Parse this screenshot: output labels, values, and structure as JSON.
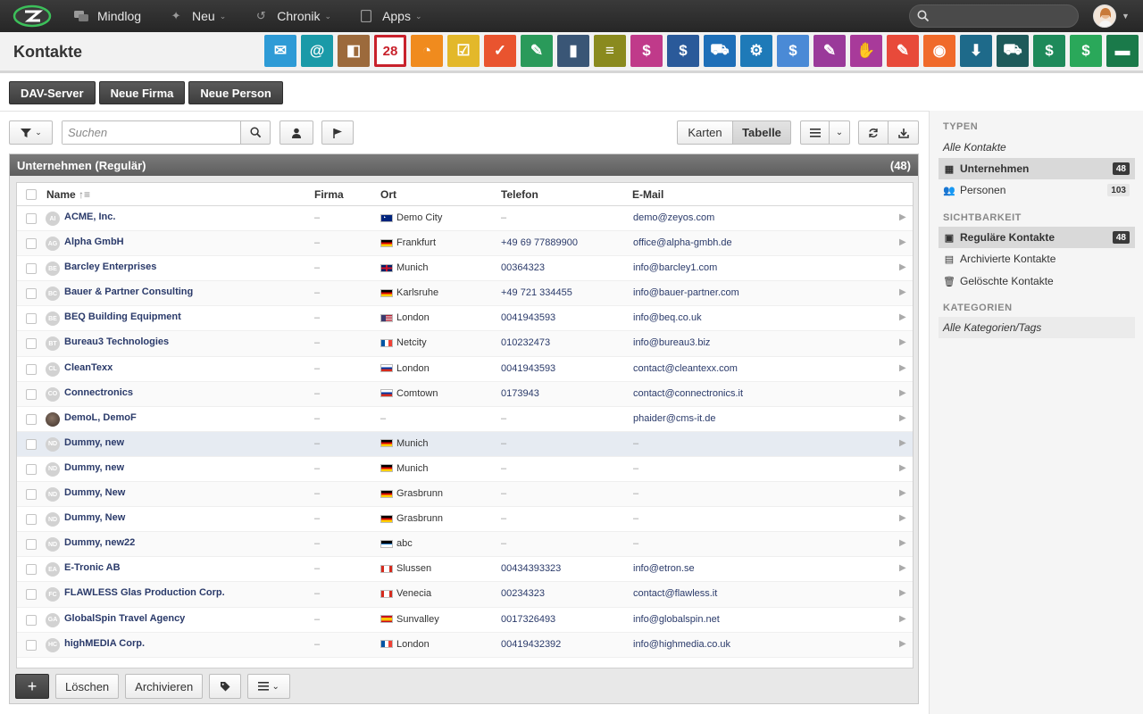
{
  "topnav": {
    "items": [
      {
        "label": "Mindlog",
        "icon": "chat-icon",
        "chevron": false
      },
      {
        "label": "Neu",
        "icon": "sparkle-icon",
        "chevron": true
      },
      {
        "label": "Chronik",
        "icon": "history-icon",
        "chevron": true
      },
      {
        "label": "Apps",
        "icon": "tablet-icon",
        "chevron": true
      }
    ],
    "search_placeholder": ""
  },
  "header": {
    "title": "Kontakte",
    "app_icons": [
      {
        "name": "mail-app",
        "color": "#2e9bd6",
        "glyph": "✉"
      },
      {
        "name": "addressbook-app",
        "color": "#1a9aa8",
        "glyph": "@"
      },
      {
        "name": "contacts-app",
        "color": "#9c6a3c",
        "glyph": "◧"
      },
      {
        "name": "calendar-app",
        "color": "#c8212b",
        "glyph": "28"
      },
      {
        "name": "timer-app",
        "color": "#f08b1e",
        "glyph": "◔"
      },
      {
        "name": "tasks-app",
        "color": "#e3b82a",
        "glyph": "☑"
      },
      {
        "name": "projects-app",
        "color": "#e9542f",
        "glyph": "✓"
      },
      {
        "name": "notes-app",
        "color": "#2a9a5a",
        "glyph": "✎"
      },
      {
        "name": "bookmark-app",
        "color": "#3a5676",
        "glyph": "▮"
      },
      {
        "name": "documents-app",
        "color": "#8a8a1e",
        "glyph": "≡"
      },
      {
        "name": "cashdesk-app",
        "color": "#c03a8a",
        "glyph": "$"
      },
      {
        "name": "finance-app",
        "color": "#2a5a9a",
        "glyph": "$"
      },
      {
        "name": "delivery-app",
        "color": "#1e6fb8",
        "glyph": "⛟"
      },
      {
        "name": "support-app",
        "color": "#1e7ab8",
        "glyph": "⚙"
      },
      {
        "name": "money-app",
        "color": "#4a8ad6",
        "glyph": "$"
      },
      {
        "name": "contracts-app",
        "color": "#9a3a9a",
        "glyph": "✎"
      },
      {
        "name": "deals-app",
        "color": "#a83a9a",
        "glyph": "✋"
      },
      {
        "name": "pdf-app",
        "color": "#e84a3a",
        "glyph": "✎"
      },
      {
        "name": "broadcast-app",
        "color": "#f06a2a",
        "glyph": "◉"
      },
      {
        "name": "download-app",
        "color": "#1e6a8a",
        "glyph": "⬇"
      },
      {
        "name": "shop-app",
        "color": "#1e5a5a",
        "glyph": "⛟"
      },
      {
        "name": "billing-app",
        "color": "#1e8a5a",
        "glyph": "$"
      },
      {
        "name": "tags-app",
        "color": "#2aa85a",
        "glyph": "$"
      },
      {
        "name": "database-app",
        "color": "#1a7a4a",
        "glyph": "▬"
      }
    ]
  },
  "actions": {
    "dav": "DAV-Server",
    "new_company": "Neue Firma",
    "new_person": "Neue Person"
  },
  "toolbar": {
    "search_placeholder": "Suchen",
    "view_cards": "Karten",
    "view_table": "Tabelle"
  },
  "panel": {
    "title": "Unternehmen (Regulär)",
    "count": "(48)",
    "columns": [
      "Name",
      "Firma",
      "Ort",
      "Telefon",
      "E-Mail"
    ],
    "rows": [
      {
        "initials": "AI",
        "name": "ACME, Inc.",
        "firma": "–",
        "flag": "au",
        "ort": "Demo City",
        "tel": "–",
        "mail": "demo@zeyos.com"
      },
      {
        "initials": "AG",
        "name": "Alpha GmbH",
        "firma": "–",
        "flag": "de",
        "ort": "Frankfurt",
        "tel": "+49 69 77889900",
        "mail": "office@alpha-gmbh.de"
      },
      {
        "initials": "BE",
        "name": "Barcley Enterprises",
        "firma": "–",
        "flag": "gb",
        "ort": "Munich",
        "tel": "00364323",
        "mail": "info@barcley1.com"
      },
      {
        "initials": "BC",
        "name": "Bauer & Partner Consulting",
        "firma": "–",
        "flag": "de",
        "ort": "Karlsruhe",
        "tel": "+49 721 334455",
        "mail": "info@bauer-partner.com"
      },
      {
        "initials": "BE",
        "name": "BEQ Building Equipment",
        "firma": "–",
        "flag": "us",
        "ort": "London",
        "tel": "0041943593",
        "mail": "info@beq.co.uk"
      },
      {
        "initials": "BT",
        "name": "Bureau3 Technologies",
        "firma": "–",
        "flag": "fr",
        "ort": "Netcity",
        "tel": "010232473",
        "mail": "info@bureau3.biz"
      },
      {
        "initials": "CL",
        "name": "CleanTexx",
        "firma": "–",
        "flag": "ru",
        "ort": "London",
        "tel": "0041943593",
        "mail": "contact@cleantexx.com"
      },
      {
        "initials": "CO",
        "name": "Connectronics",
        "firma": "–",
        "flag": "ru",
        "ort": "Comtown",
        "tel": "0173943",
        "mail": "contact@connectronics.it"
      },
      {
        "initials": "",
        "name": "DemoL, DemoF",
        "firma": "–",
        "flag": "",
        "ort": "–",
        "tel": "–",
        "mail": "phaider@cms-it.de",
        "photo": true
      },
      {
        "initials": "ND",
        "name": "Dummy, new",
        "firma": "–",
        "flag": "de",
        "ort": "Munich",
        "tel": "–",
        "mail": "–",
        "selected": true
      },
      {
        "initials": "ND",
        "name": "Dummy, new",
        "firma": "–",
        "flag": "de",
        "ort": "Munich",
        "tel": "–",
        "mail": "–"
      },
      {
        "initials": "ND",
        "name": "Dummy, New",
        "firma": "–",
        "flag": "de",
        "ort": "Grasbrunn",
        "tel": "–",
        "mail": "–"
      },
      {
        "initials": "ND",
        "name": "Dummy, New",
        "firma": "–",
        "flag": "de",
        "ort": "Grasbrunn",
        "tel": "–",
        "mail": "–"
      },
      {
        "initials": "ND",
        "name": "Dummy, new22",
        "firma": "–",
        "flag": "ag",
        "ort": "abc",
        "tel": "–",
        "mail": "–"
      },
      {
        "initials": "EA",
        "name": "E-Tronic AB",
        "firma": "–",
        "flag": "ca",
        "ort": "Slussen",
        "tel": "00434393323",
        "mail": "info@etron.se"
      },
      {
        "initials": "FC",
        "name": "FLAWLESS Glas Production Corp.",
        "firma": "–",
        "flag": "ca",
        "ort": "Venecia",
        "tel": "00234323",
        "mail": "contact@flawless.it"
      },
      {
        "initials": "GA",
        "name": "GlobalSpin Travel Agency",
        "firma": "–",
        "flag": "es",
        "ort": "Sunvalley",
        "tel": "0017326493",
        "mail": "info@globalspin.net"
      },
      {
        "initials": "HC",
        "name": "highMEDIA Corp.",
        "firma": "–",
        "flag": "fr",
        "ort": "London",
        "tel": "00419432392",
        "mail": "info@highmedia.co.uk"
      }
    ]
  },
  "footer": {
    "add": "+",
    "delete": "Löschen",
    "archive": "Archivieren"
  },
  "sidebar": {
    "types_title": "TYPEN",
    "all_contacts": "Alle Kontakte",
    "companies": "Unternehmen",
    "companies_count": "48",
    "persons": "Personen",
    "persons_count": "103",
    "visibility_title": "SICHTBARKEIT",
    "regular": "Reguläre Kontakte",
    "regular_count": "48",
    "archived": "Archivierte Kontakte",
    "deleted": "Gelöschte Kontakte",
    "categories_title": "KATEGORIEN",
    "all_categories": "Alle Kategorien/Tags"
  }
}
